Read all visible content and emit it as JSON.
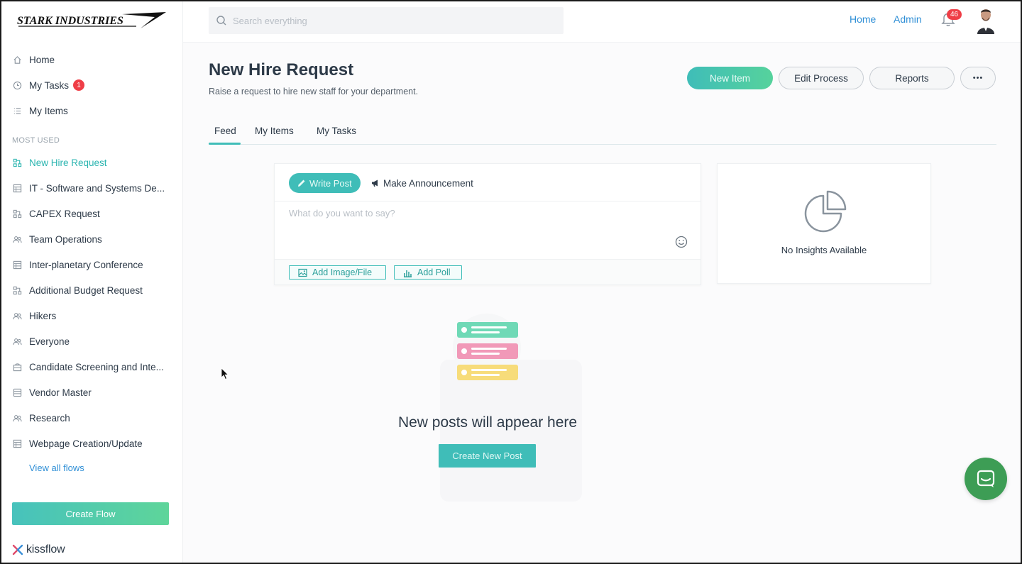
{
  "sidebar": {
    "brand": "STARK INDUSTRIES",
    "nav": [
      {
        "label": "Home",
        "icon": "home-icon"
      },
      {
        "label": "My Tasks",
        "icon": "clock-icon",
        "badge": "1"
      },
      {
        "label": "My Items",
        "icon": "list-icon"
      }
    ],
    "section_title": "MOST USED",
    "flows": [
      {
        "label": "New Hire Request",
        "icon": "flow-icon",
        "active": true
      },
      {
        "label": "IT - Software and Systems De...",
        "icon": "table-icon"
      },
      {
        "label": "CAPEX Request",
        "icon": "flow-icon"
      },
      {
        "label": "Team Operations",
        "icon": "people-icon"
      },
      {
        "label": "Inter-planetary Conference",
        "icon": "table-icon"
      },
      {
        "label": "Additional Budget Request",
        "icon": "flow-icon"
      },
      {
        "label": "Hikers",
        "icon": "people-icon"
      },
      {
        "label": "Everyone",
        "icon": "people-icon"
      },
      {
        "label": "Candidate Screening and Inte...",
        "icon": "case-icon"
      },
      {
        "label": "Vendor Master",
        "icon": "database-icon"
      },
      {
        "label": "Research",
        "icon": "people-icon"
      },
      {
        "label": "Webpage Creation/Update",
        "icon": "table-icon"
      }
    ],
    "view_all": "View all flows",
    "create_flow": "Create Flow",
    "footer_brand": "kissflow"
  },
  "topbar": {
    "search_placeholder": "Search everything",
    "home_link": "Home",
    "admin_link": "Admin",
    "notification_count": "46"
  },
  "header": {
    "title": "New Hire Request",
    "subtitle": "Raise a request to hire new staff for your department.",
    "new_item": "New Item",
    "edit_process": "Edit Process",
    "reports": "Reports",
    "more": "•••"
  },
  "tabs": [
    "Feed",
    "My Items",
    "My Tasks"
  ],
  "composer": {
    "write_post": "Write Post",
    "announcement": "Make Announcement",
    "placeholder": "What do you want to say?",
    "add_image": "Add Image/File",
    "add_poll": "Add Poll"
  },
  "insights": {
    "empty_text": "No Insights Available"
  },
  "empty_state": {
    "title": "New posts will appear here",
    "button": "Create New Post"
  },
  "colors": {
    "accent": "#3fbdb8",
    "link": "#2f8fd6",
    "badge": "#ef3e47",
    "chat": "#3d9d55"
  }
}
